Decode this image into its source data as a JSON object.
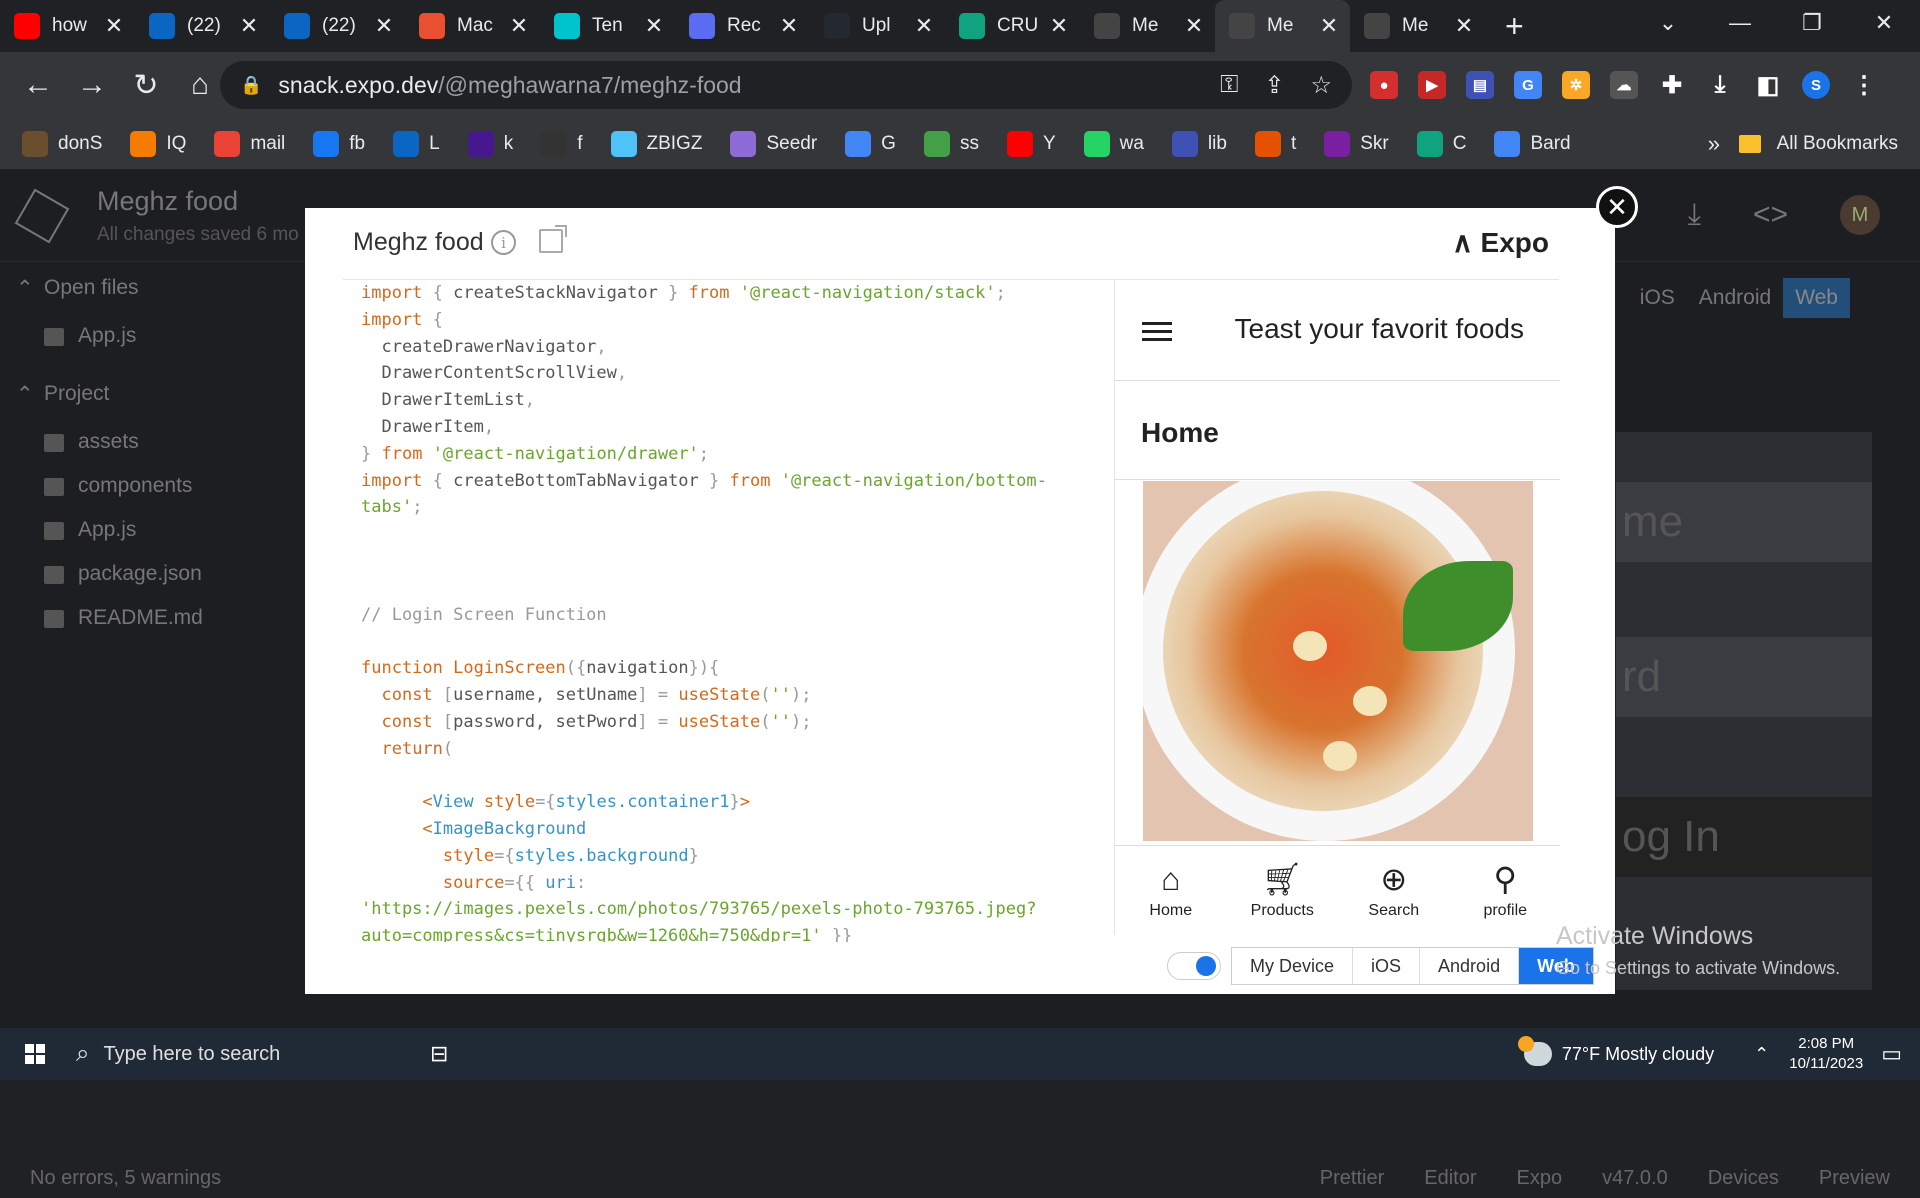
{
  "browser": {
    "tabs": [
      {
        "title": "how",
        "icon": "youtube-icon",
        "color": "#ff0000"
      },
      {
        "title": "(22)",
        "icon": "linkedin-icon",
        "color": "#0a66c2"
      },
      {
        "title": "(22)",
        "icon": "linkedin-icon",
        "color": "#0a66c2"
      },
      {
        "title": "Mac",
        "icon": "m-icon",
        "color": "#e8502f"
      },
      {
        "title": "Ten",
        "icon": "canva-icon",
        "color": "#00c4cc"
      },
      {
        "title": "Rec",
        "icon": "screen-recorder-icon",
        "color": "#5b6cf3"
      },
      {
        "title": "Upl",
        "icon": "github-icon",
        "color": "#24292f"
      },
      {
        "title": "CRU",
        "icon": "chatgpt-icon",
        "color": "#10a37f"
      },
      {
        "title": "Me",
        "icon": "snack-icon",
        "color": "#444"
      },
      {
        "title": "Me",
        "icon": "snack-icon",
        "color": "#444"
      },
      {
        "title": "Me",
        "icon": "snack-icon",
        "color": "#444"
      }
    ],
    "active_tab_index": 9,
    "url_host": "snack.expo.dev",
    "url_path": "/@meghawarna7/meghz-food",
    "profile_initial": "S",
    "bookmarks": [
      {
        "label": "donS",
        "icon": "bookmark-icon",
        "color": "#6b4e2e"
      },
      {
        "label": "IQ",
        "icon": "chart-icon",
        "color": "#f57c00"
      },
      {
        "label": "mail",
        "icon": "gmail-icon",
        "color": "#ea4335"
      },
      {
        "label": "fb",
        "icon": "facebook-icon",
        "color": "#1877f2"
      },
      {
        "label": "L",
        "icon": "linkedin-icon",
        "color": "#0a66c2"
      },
      {
        "label": "k",
        "icon": "kahoot-icon",
        "color": "#46178f"
      },
      {
        "label": "f",
        "icon": "bird-icon",
        "color": "#333"
      },
      {
        "label": "ZBIGZ",
        "icon": "cloud-icon",
        "color": "#4fc3f7"
      },
      {
        "label": "Seedr",
        "icon": "seed-icon",
        "color": "#8e6cd8"
      },
      {
        "label": "G",
        "icon": "translate-icon",
        "color": "#4285f4"
      },
      {
        "label": "ss",
        "icon": "download-arrow-icon",
        "color": "#43a047"
      },
      {
        "label": "Y",
        "icon": "youtube-icon",
        "color": "#ff0000"
      },
      {
        "label": "wa",
        "icon": "whatsapp-icon",
        "color": "#25d366"
      },
      {
        "label": "lib",
        "icon": "library-icon",
        "color": "#3f51b5"
      },
      {
        "label": "t",
        "icon": "x-icon",
        "color": "#e65100"
      },
      {
        "label": "Skr",
        "icon": "skr-icon",
        "color": "#7b1fa2"
      },
      {
        "label": "C",
        "icon": "chatgpt-icon",
        "color": "#10a37f"
      },
      {
        "label": "Bard",
        "icon": "bard-icon",
        "color": "#4285f4"
      }
    ],
    "bookmarks_more": "»",
    "all_bookmarks": "All Bookmarks"
  },
  "snack": {
    "project_title": "Meghz food",
    "saved_status": "All changes saved 6 mo",
    "open_files_label": "Open files",
    "open_files": [
      "App.js"
    ],
    "project_label": "Project",
    "project_items": [
      "assets",
      "components",
      "App.js",
      "package.json",
      "README.md"
    ],
    "platform_tabs": [
      "iOS",
      "Android",
      "Web"
    ],
    "avatar_initial": "M",
    "bg_preview_words": [
      "me",
      "rd",
      "og In"
    ],
    "status_left": "No errors, 5 warnings",
    "status_right": [
      "Prettier",
      "Editor",
      "Expo",
      "v47.0.0",
      "Devices",
      "Preview"
    ]
  },
  "modal": {
    "title": "Meghz food",
    "expo_label": "Expo",
    "code_lines": [
      [
        [
          "kw",
          "import"
        ],
        [
          "pun",
          " { "
        ],
        [
          "plain",
          "createStackNavigator"
        ],
        [
          "pun",
          " } "
        ],
        [
          "kw",
          "from"
        ],
        [
          "plain",
          " "
        ],
        [
          "str",
          "'@react-navigation/stack'"
        ],
        [
          "pun",
          ";"
        ]
      ],
      [
        [
          "kw",
          "import"
        ],
        [
          "pun",
          " {"
        ]
      ],
      [
        [
          "plain",
          "  createDrawerNavigator"
        ],
        [
          "pun",
          ","
        ]
      ],
      [
        [
          "plain",
          "  DrawerContentScrollView"
        ],
        [
          "pun",
          ","
        ]
      ],
      [
        [
          "plain",
          "  DrawerItemList"
        ],
        [
          "pun",
          ","
        ]
      ],
      [
        [
          "plain",
          "  DrawerItem"
        ],
        [
          "pun",
          ","
        ]
      ],
      [
        [
          "pun",
          "} "
        ],
        [
          "kw",
          "from"
        ],
        [
          "plain",
          " "
        ],
        [
          "str",
          "'@react-navigation/drawer'"
        ],
        [
          "pun",
          ";"
        ]
      ],
      [
        [
          "kw",
          "import"
        ],
        [
          "pun",
          " { "
        ],
        [
          "plain",
          "createBottomTabNavigator"
        ],
        [
          "pun",
          " } "
        ],
        [
          "kw",
          "from"
        ],
        [
          "plain",
          " "
        ],
        [
          "str",
          "'@react-navigation/bottom-"
        ]
      ],
      [
        [
          "str",
          "tabs'"
        ],
        [
          "pun",
          ";"
        ]
      ],
      [],
      [],
      [],
      [
        [
          "cm",
          "// Login Screen Function"
        ]
      ],
      [],
      [
        [
          "kw",
          "function"
        ],
        [
          "plain",
          " "
        ],
        [
          "kw",
          "LoginScreen"
        ],
        [
          "pun",
          "({"
        ],
        [
          "plain",
          "navigation"
        ],
        [
          "pun",
          "}){"
        ]
      ],
      [
        [
          "plain",
          "  "
        ],
        [
          "kw",
          "const"
        ],
        [
          "plain",
          " "
        ],
        [
          "pun",
          "["
        ],
        [
          "plain",
          "username, setUname"
        ],
        [
          "pun",
          "] = "
        ],
        [
          "kw",
          "useState"
        ],
        [
          "pun",
          "("
        ],
        [
          "str",
          "''"
        ],
        [
          "pun",
          ");"
        ]
      ],
      [
        [
          "plain",
          "  "
        ],
        [
          "kw",
          "const"
        ],
        [
          "plain",
          " "
        ],
        [
          "pun",
          "["
        ],
        [
          "plain",
          "password, setPword"
        ],
        [
          "pun",
          "] = "
        ],
        [
          "kw",
          "useState"
        ],
        [
          "pun",
          "("
        ],
        [
          "str",
          "''"
        ],
        [
          "pun",
          ");"
        ]
      ],
      [
        [
          "plain",
          "  "
        ],
        [
          "kw",
          "return"
        ],
        [
          "pun",
          "("
        ]
      ],
      [],
      [
        [
          "plain",
          "      "
        ],
        [
          "kw",
          "<"
        ],
        [
          "tg",
          "View"
        ],
        [
          "plain",
          " "
        ],
        [
          "kw",
          "style"
        ],
        [
          "pun",
          "={"
        ],
        [
          "tg",
          "styles.container1"
        ],
        [
          "pun",
          "}"
        ],
        [
          "kw",
          ">"
        ]
      ],
      [
        [
          "plain",
          "      "
        ],
        [
          "kw",
          "<"
        ],
        [
          "tg",
          "ImageBackground"
        ]
      ],
      [
        [
          "plain",
          "        "
        ],
        [
          "kw",
          "style"
        ],
        [
          "pun",
          "={"
        ],
        [
          "tg",
          "styles.background"
        ],
        [
          "pun",
          "}"
        ]
      ],
      [
        [
          "plain",
          "        "
        ],
        [
          "kw",
          "source"
        ],
        [
          "pun",
          "={{ "
        ],
        [
          "tg",
          "uri"
        ],
        [
          "pun",
          ":"
        ]
      ],
      [
        [
          "str",
          "'https://images.pexels.com/photos/793765/pexels-photo-793765.jpeg?"
        ]
      ],
      [
        [
          "str",
          "auto=compress&cs=tinysrgb&w=1260&h=750&dpr=1'"
        ],
        [
          "pun",
          " }}"
        ]
      ]
    ],
    "phone": {
      "header_title": "Teast your favorit foods",
      "screen_title": "Home",
      "tabs": [
        {
          "label": "Home",
          "icon": "home-icon"
        },
        {
          "label": "Products",
          "icon": "cart-icon"
        },
        {
          "label": "Search",
          "icon": "plus-circle-icon"
        },
        {
          "label": "profile",
          "icon": "user-icon"
        }
      ]
    },
    "device_options": [
      "My Device",
      "iOS",
      "Android",
      "Web"
    ],
    "selected_device": "Web"
  },
  "windows": {
    "activate_title": "Activate Windows",
    "activate_sub": "Go to Settings to activate Windows.",
    "search_placeholder": "Type here to search",
    "weather": "77°F  Mostly cloudy",
    "time": "2:08 PM",
    "date": "10/11/2023"
  },
  "colors": {
    "accent": "#1a73e8",
    "chrome_bg": "#202124",
    "expo_keyword": "#d4691a",
    "expo_string": "#6aa62b"
  }
}
